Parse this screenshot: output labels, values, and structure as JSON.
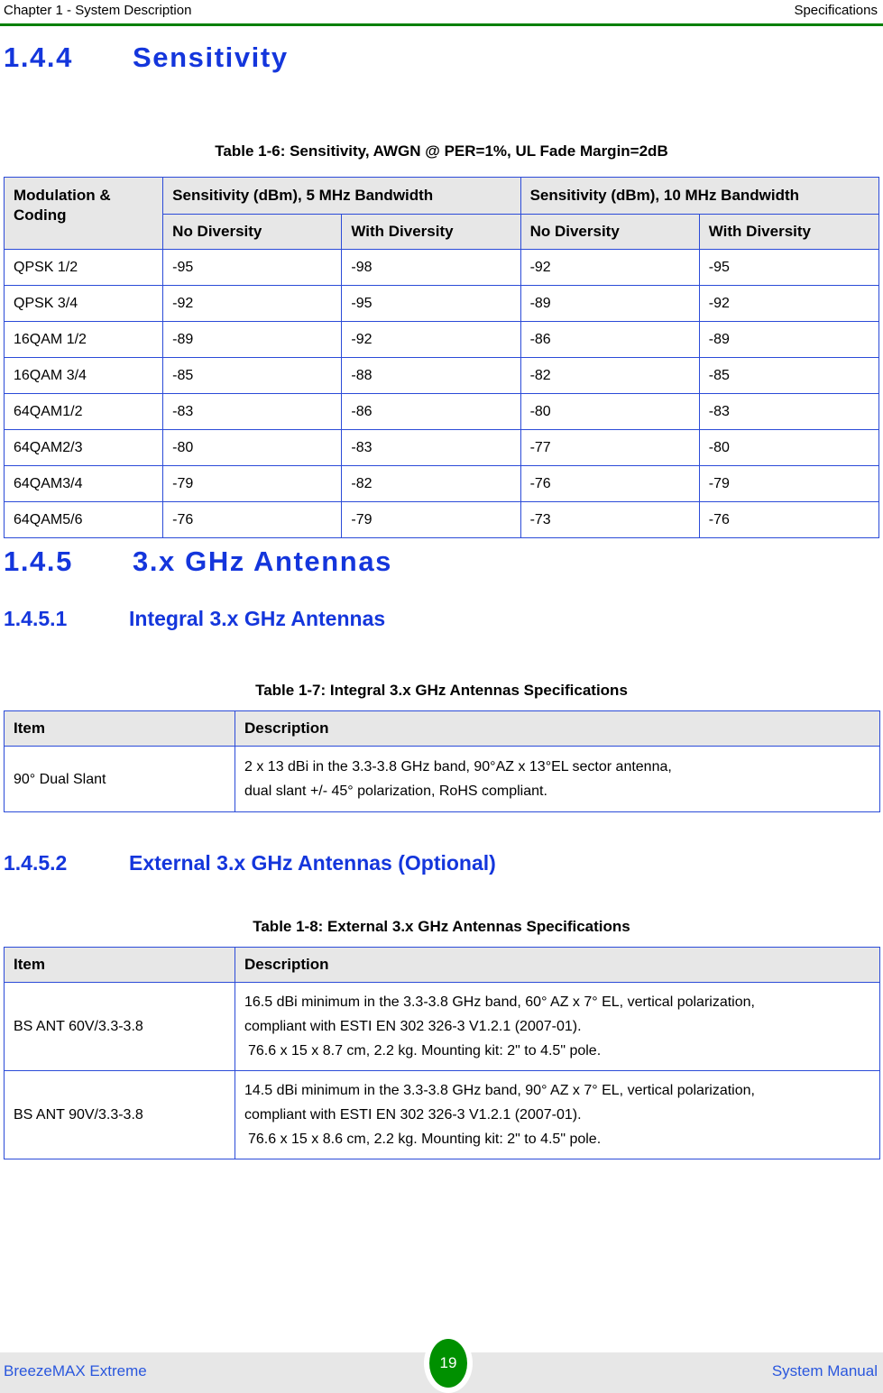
{
  "header": {
    "left": "Chapter 1 - System Description",
    "right": "Specifications",
    "rule_color": "#008000"
  },
  "sections": {
    "s144": {
      "number": "1.4.4",
      "title": "Sensitivity"
    },
    "s145": {
      "number": "1.4.5",
      "title": "3.x GHz Antennas"
    },
    "s1451": {
      "number": "1.4.5.1",
      "title": "Integral 3.x GHz Antennas"
    },
    "s1452": {
      "number": "1.4.5.2",
      "title": "External 3.x GHz Antennas (Optional)"
    }
  },
  "table_1_6": {
    "caption": "Table 1-6: Sensitivity, AWGN @ PER=1%, UL Fade Margin=2dB",
    "header_group": {
      "col0": "Modulation & Coding",
      "group_5mhz": "Sensitivity (dBm), 5 MHz Bandwidth",
      "group_10mhz": "Sensitivity (dBm), 10 MHz Bandwidth"
    },
    "header_sub": {
      "h1": "No Diversity",
      "h2": "With Diversity",
      "h3": "No Diversity",
      "h4": "With Diversity"
    },
    "rows": [
      {
        "modulation": "QPSK 1/2",
        "mhz5_no": "-95",
        "mhz5_with": "-98",
        "mhz10_no": "-92",
        "mhz10_with": "-95"
      },
      {
        "modulation": "QPSK 3/4",
        "mhz5_no": "-92",
        "mhz5_with": "-95",
        "mhz10_no": "-89",
        "mhz10_with": "-92"
      },
      {
        "modulation": "16QAM 1/2",
        "mhz5_no": "-89",
        "mhz5_with": "-92",
        "mhz10_no": "-86",
        "mhz10_with": "-89"
      },
      {
        "modulation": "16QAM 3/4",
        "mhz5_no": "-85",
        "mhz5_with": "-88",
        "mhz10_no": "-82",
        "mhz10_with": "-85"
      },
      {
        "modulation": "64QAM1/2",
        "mhz5_no": "-83",
        "mhz5_with": "-86",
        "mhz10_no": "-80",
        "mhz10_with": "-83"
      },
      {
        "modulation": "64QAM2/3",
        "mhz5_no": "-80",
        "mhz5_with": "-83",
        "mhz10_no": "-77",
        "mhz10_with": "-80"
      },
      {
        "modulation": "64QAM3/4",
        "mhz5_no": "-79",
        "mhz5_with": "-82",
        "mhz10_no": "-76",
        "mhz10_with": "-79"
      },
      {
        "modulation": "64QAM5/6",
        "mhz5_no": "-76",
        "mhz5_with": "-79",
        "mhz10_no": "-73",
        "mhz10_with": "-76"
      }
    ]
  },
  "table_1_7": {
    "caption": "Table 1-7: Integral 3.x GHz Antennas Specifications",
    "columns": {
      "item": "Item",
      "description": "Description"
    },
    "rows": [
      {
        "item": "90° Dual Slant",
        "desc_line1": "2 x 13 dBi in the 3.3-3.8 GHz band, 90°AZ x 13°EL sector antenna,",
        "desc_line2": "dual slant +/- 45° polarization, RoHS compliant.",
        "desc_line3": ""
      }
    ]
  },
  "table_1_8": {
    "caption": "Table 1-8: External 3.x GHz Antennas Specifications",
    "columns": {
      "item": "Item",
      "description": "Description"
    },
    "rows": [
      {
        "item": "BS ANT 60V/3.3-3.8",
        "desc_line1": "16.5 dBi minimum in the 3.3-3.8 GHz band, 60° AZ x 7° EL, vertical polarization,",
        "desc_line2": "compliant with ESTI EN 302 326-3 V1.2.1 (2007-01).",
        "desc_line3": "76.6 x 15 x 8.7 cm, 2.2 kg. Mounting kit: 2\" to 4.5\" pole."
      },
      {
        "item": "BS ANT 90V/3.3-3.8",
        "desc_line1": "14.5 dBi minimum in the 3.3-3.8 GHz band, 90° AZ x 7° EL, vertical polarization,",
        "desc_line2": "compliant with ESTI EN 302 326-3 V1.2.1 (2007-01).",
        "desc_line3": "76.6 x 15 x 8.6 cm, 2.2 kg. Mounting kit: 2\" to 4.5\" pole."
      }
    ]
  },
  "footer": {
    "left": "BreezeMAX Extreme",
    "page_number": "19",
    "right": "System Manual",
    "badge_color": "#009000",
    "text_color": "#2a57dd"
  }
}
